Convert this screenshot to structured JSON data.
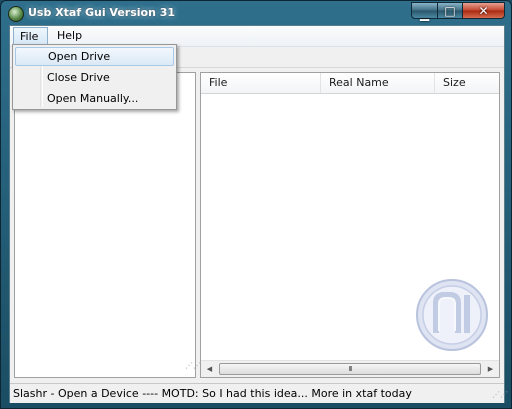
{
  "window": {
    "title": "Usb Xtaf Gui Version 31",
    "buttons": {
      "minimize_icon": "minimize-icon",
      "maximize_icon": "maximize-icon",
      "close_icon": "close-icon"
    }
  },
  "menubar": {
    "items": [
      {
        "label": "File"
      },
      {
        "label": "Help"
      }
    ]
  },
  "file_menu": {
    "items": [
      {
        "label": "Open Drive",
        "highlighted": true
      },
      {
        "label": "Close  Drive"
      },
      {
        "label": "Open Manually..."
      }
    ]
  },
  "file_list": {
    "columns": [
      {
        "label": "File"
      },
      {
        "label": "Real Name"
      },
      {
        "label": "Size"
      }
    ],
    "rows": []
  },
  "scrollbar": {
    "thumb_grip": "III"
  },
  "statusbar": {
    "text": "Slashr - Open a Device ---- MOTD: So I had this idea... More in xtaf today"
  },
  "colors": {
    "accent": "#2f6f8c",
    "menu_highlight": "#dbe9f6"
  }
}
